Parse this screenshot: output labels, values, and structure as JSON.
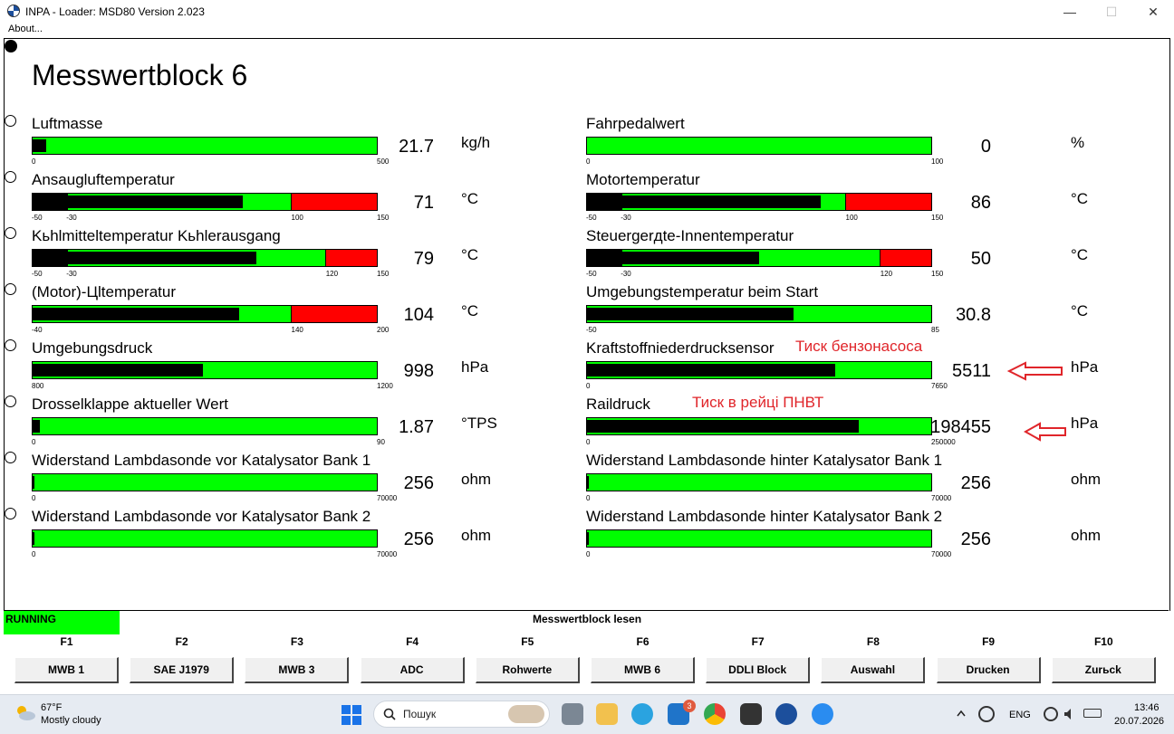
{
  "window": {
    "title": "INPA - Loader:  MSD80 Version 2.023",
    "minimize": "—",
    "maximize": "☐",
    "close": "✕"
  },
  "menu": {
    "about": "About..."
  },
  "page_title": "Messwertblock 6",
  "left": [
    {
      "label": "Luftmasse",
      "value": "21.7",
      "unit": "kg/h",
      "level": 0.04,
      "segments": [],
      "ticks": [
        "0",
        "500"
      ]
    },
    {
      "label": "Ansaugluftemperatur",
      "value": "71",
      "unit": "°C",
      "level": 0.61,
      "segments": [
        "black",
        "green",
        "red"
      ],
      "ticks": [
        "-50",
        "-30",
        "100",
        "150"
      ]
    },
    {
      "label": "Kьhlmitteltemperatur Kьhlerausgang",
      "value": "79",
      "unit": "°C",
      "level": 0.65,
      "segments": [
        "black",
        "green",
        "red"
      ],
      "ticks": [
        "-50",
        "-30",
        "120",
        "150"
      ]
    },
    {
      "label": "(Motor)-Цltemperatur",
      "value": "104",
      "unit": "°C",
      "level": 0.6,
      "segments": [
        "green",
        "red"
      ],
      "ticks": [
        "-40",
        "140",
        "200"
      ]
    },
    {
      "label": "Umgebungsdruck",
      "value": "998",
      "unit": "hPa",
      "level": 0.495,
      "segments": [],
      "ticks": [
        "800",
        "1200"
      ]
    },
    {
      "label": "Drosselklappe aktueller Wert",
      "value": "1.87",
      "unit": "°TPS",
      "level": 0.02,
      "segments": [],
      "ticks": [
        "0",
        "90"
      ]
    },
    {
      "label": "Widerstand Lambdasonde vor Katalysator Bank 1",
      "value": "256",
      "unit": "ohm",
      "level": 0.004,
      "segments": [],
      "ticks": [
        "0",
        "70000"
      ]
    },
    {
      "label": "Widerstand Lambdasonde vor Katalysator Bank 2",
      "value": "256",
      "unit": "ohm",
      "level": 0.004,
      "segments": [],
      "ticks": [
        "0",
        "70000"
      ]
    }
  ],
  "right": [
    {
      "label": "Fahrpedalwert",
      "value": "0",
      "unit": "%",
      "level": 0,
      "segments": [],
      "ticks": [
        "0",
        "100"
      ]
    },
    {
      "label": "Motortemperatur",
      "value": "86",
      "unit": "°C",
      "level": 0.68,
      "segments": [
        "black",
        "green",
        "red"
      ],
      "ticks": [
        "-50",
        "-30",
        "100",
        "150"
      ]
    },
    {
      "label": "Steuergerдte-Innentemperatur",
      "value": "50",
      "unit": "°C",
      "level": 0.5,
      "segments": [
        "black",
        "green",
        "red"
      ],
      "ticks": [
        "-50",
        "-30",
        "120",
        "150"
      ]
    },
    {
      "label": "Umgebungstemperatur beim Start",
      "value": "30.8",
      "unit": "°C",
      "level": 0.6,
      "segments": [],
      "ticks": [
        "-50",
        "85"
      ]
    },
    {
      "label": "Kraftstoffniederdrucksensor",
      "value": "5511",
      "unit": "hPa",
      "level": 0.72,
      "segments": [],
      "ticks": [
        "0",
        "7650"
      ]
    },
    {
      "label": "Raildruck",
      "value": "198455",
      "unit": "hPa",
      "level": 0.79,
      "segments": [],
      "ticks": [
        "0",
        "250000"
      ]
    },
    {
      "label": "Widerstand Lambdasonde hinter Katalysator Bank 1",
      "value": "256",
      "unit": "ohm",
      "level": 0.004,
      "segments": [],
      "ticks": [
        "0",
        "70000"
      ]
    },
    {
      "label": "Widerstand Lambdasonde hinter Katalysator Bank 2",
      "value": "256",
      "unit": "ohm",
      "level": 0.004,
      "segments": [],
      "ticks": [
        "0",
        "70000"
      ]
    }
  ],
  "annotations": {
    "fuel_pump": "Тиск бензонасоса",
    "rail": "Тиск в рейці ПНВТ"
  },
  "status": {
    "running": "RUNNING",
    "center": "Messwertblock lesen"
  },
  "fkeys": [
    {
      "key": "F1",
      "label": "MWB 1"
    },
    {
      "key": "F2",
      "label": "SAE J1979"
    },
    {
      "key": "F3",
      "label": "MWB 3"
    },
    {
      "key": "F4",
      "label": "ADC"
    },
    {
      "key": "F5",
      "label": "Rohwerte"
    },
    {
      "key": "F6",
      "label": "MWB 6"
    },
    {
      "key": "F7",
      "label": "DDLI Block"
    },
    {
      "key": "F8",
      "label": "Auswahl"
    },
    {
      "key": "F9",
      "label": "Drucken"
    },
    {
      "key": "F10",
      "label": "Zurьck"
    }
  ],
  "taskbar": {
    "temp": "67°F",
    "weather": "Mostly cloudy",
    "search_placeholder": "Пошук",
    "badge": "3",
    "lang": "ENG",
    "time": "13:46",
    "date": "20.07.2026"
  },
  "colors": {
    "bar_green": "#00ff00",
    "bar_red": "#ff0000",
    "bar_black": "#000000",
    "annotation": "#e0252a"
  }
}
